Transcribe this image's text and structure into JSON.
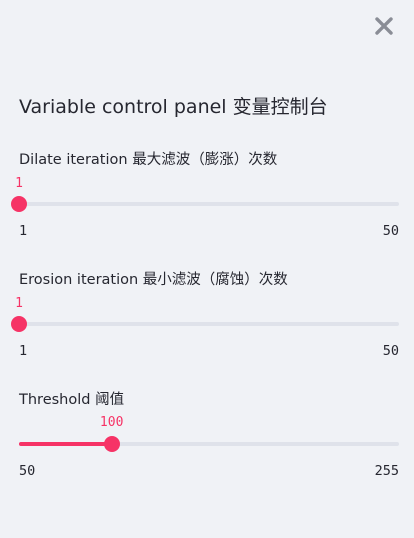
{
  "close_icon": "close-x-icon",
  "accent_color": "#f63366",
  "panel": {
    "title": "Variable control panel 变量控制台"
  },
  "sliders": [
    {
      "label": "Dilate iteration 最大滤波（膨涨）次数",
      "value": 1,
      "value_text": "1",
      "min": 1,
      "max": 50,
      "min_text": "1",
      "max_text": "50"
    },
    {
      "label": "Erosion iteration 最小滤波（腐蚀）次数",
      "value": 1,
      "value_text": "1",
      "min": 1,
      "max": 50,
      "min_text": "1",
      "max_text": "50"
    },
    {
      "label": "Threshold 阈值",
      "value": 100,
      "value_text": "100",
      "min": 50,
      "max": 255,
      "min_text": "50",
      "max_text": "255"
    }
  ]
}
